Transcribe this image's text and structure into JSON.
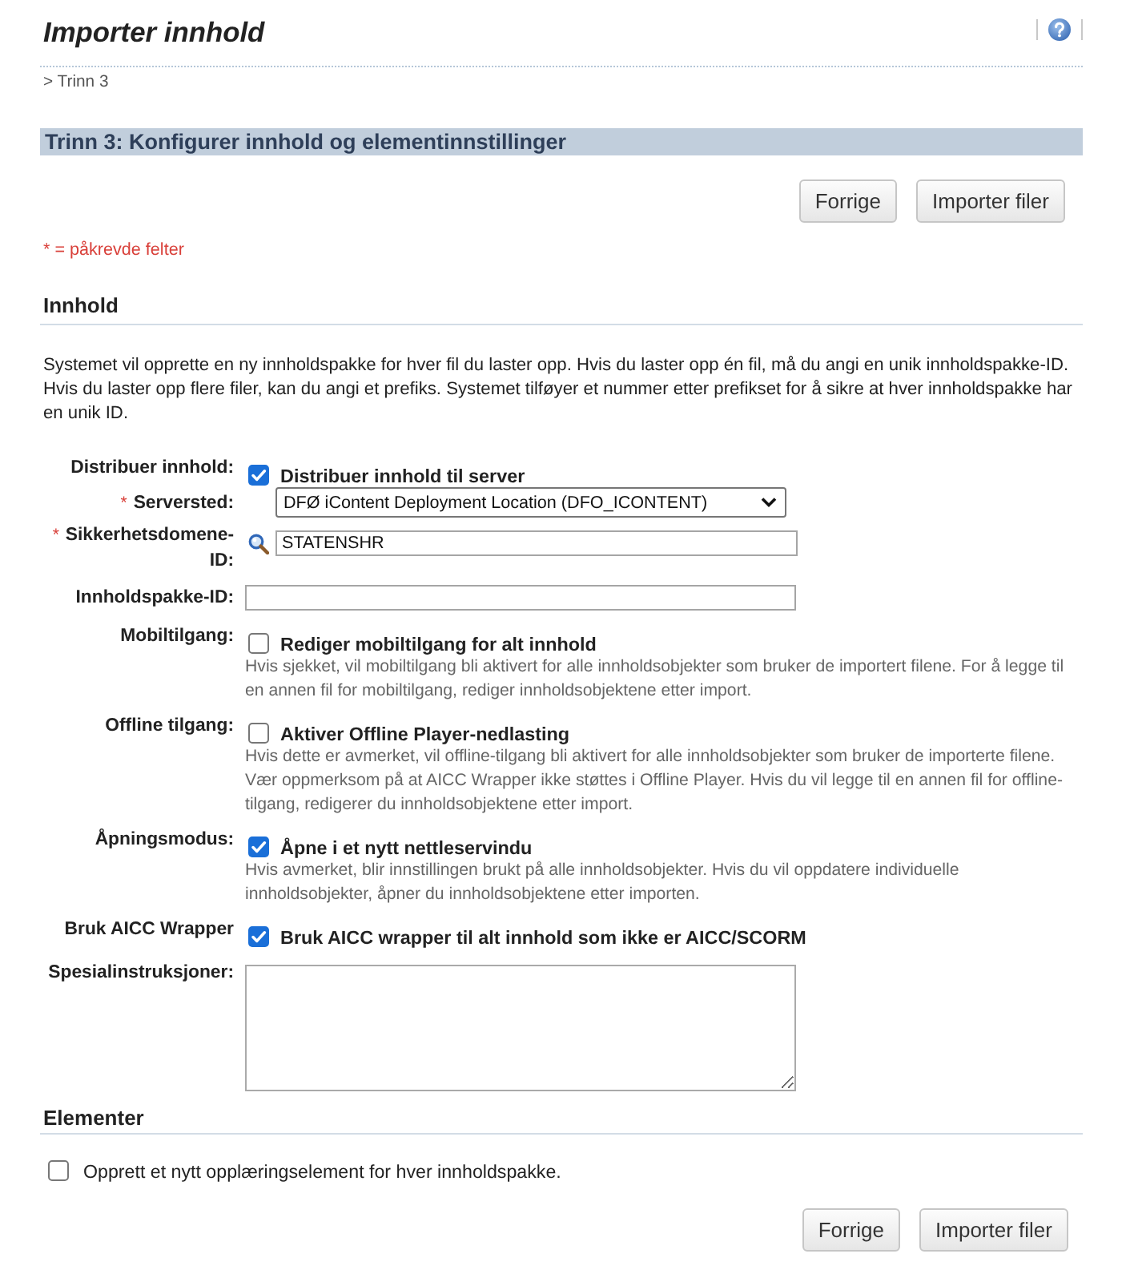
{
  "header": {
    "title": "Importer innhold"
  },
  "breadcrumb": "> Trinn 3",
  "step_bar": {
    "title": "Trinn 3: Konfigurer innhold og elementinnstillinger"
  },
  "top_buttons": [
    {
      "label": "Forrige"
    },
    {
      "label": "Importer filer"
    }
  ],
  "required_note": "* = påkrevde felter",
  "content_section": {
    "heading": "Innhold",
    "description": "Systemet vil opprette en ny innholdspakke for hver fil du laster opp. Hvis du laster opp én fil, må du angi en unik innholdspakke-ID. Hvis du laster opp flere filer, kan du angi et prefiks. Systemet tilføyer et nummer etter prefikset for å sikre at hver innholdspakke har en unik ID.",
    "fields": [
      {
        "kind": "checkbox",
        "label": "Distribuer innhold:",
        "checked": true,
        "option": "Distribuer innhold til server"
      },
      {
        "kind": "select",
        "required_mark": "*",
        "label": "Serversted:",
        "value": "DFØ iContent Deployment Location (DFO_ICONTENT)"
      },
      {
        "kind": "lookup",
        "required_mark": "*",
        "label": "Sikkerhetsdomene-ID:",
        "value": "STATENSHR"
      },
      {
        "kind": "text",
        "label": "Innholdspakke-ID:"
      },
      {
        "kind": "checkbox",
        "label": "Mobiltilgang:",
        "checked": false,
        "option": "Rediger mobiltilgang for alt innhold",
        "hint": "Hvis sjekket, vil mobiltilgang bli aktivert for alle innholdsobjekter som bruker de importert filene. For å legge til en annen fil for mobiltilgang, rediger innholdsobjektene etter import."
      },
      {
        "kind": "checkbox",
        "label": "Offline tilgang:",
        "checked": false,
        "option": "Aktiver Offline Player-nedlasting",
        "hint": "Hvis dette er avmerket, vil offline-tilgang bli aktivert for alle innholdsobjekter som bruker de importerte filene. Vær oppmerksom på at AICC Wrapper ikke støttes i Offline Player. Hvis du vil legge til en annen fil for offline-tilgang, redigerer du innholdsobjektene etter import."
      },
      {
        "kind": "checkbox",
        "label": "Åpningsmodus:",
        "checked": true,
        "option": "Åpne i et nytt nettleservindu",
        "hint": "Hvis avmerket, blir innstillingen brukt på alle innholdsobjekter. Hvis du vil oppdatere individuelle innholdsobjekter, åpner du innholdsobjektene etter importen."
      },
      {
        "kind": "checkbox",
        "label": "Bruk AICC Wrapper",
        "checked": true,
        "option": "Bruk AICC wrapper til alt innhold som ikke er AICC/SCORM"
      },
      {
        "kind": "textarea",
        "label": "Spesialinstruksjoner:"
      }
    ]
  },
  "elements_section": {
    "heading": "Elementer",
    "option": {
      "label": "Opprett et nytt opplæringselement for hver innholdspakke.",
      "checked": false
    }
  },
  "bottom_buttons": [
    {
      "label": "Forrige"
    },
    {
      "label": "Importer filer"
    }
  ]
}
